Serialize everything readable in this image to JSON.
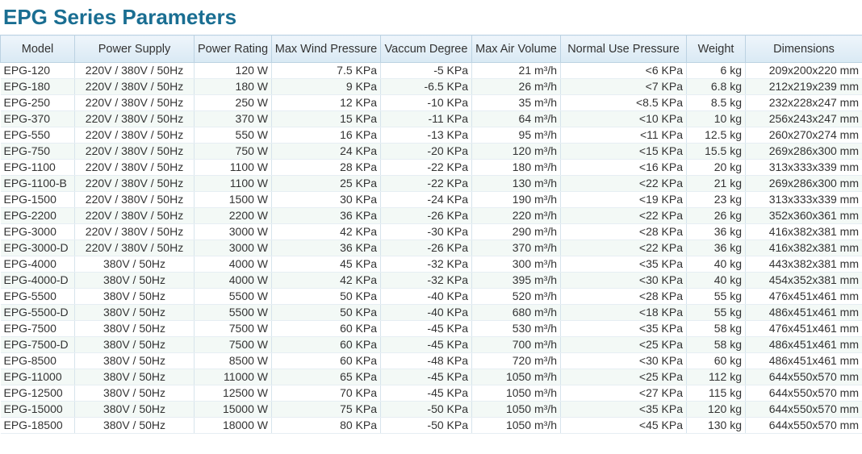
{
  "title": "EPG Series Parameters",
  "table": {
    "headers": [
      "Model",
      "Power Supply",
      "Power Rating",
      "Max Wind Pressure",
      "Vaccum Degree",
      "Max Air Volume",
      "Normal Use Pressure",
      "Weight",
      "Dimensions"
    ],
    "rows": [
      [
        "EPG-120",
        "220V / 380V / 50Hz",
        "120 W",
        "7.5 KPa",
        "-5 KPa",
        "21 m³/h",
        "<6 KPa",
        "6 kg",
        "209x200x220 mm"
      ],
      [
        "EPG-180",
        "220V / 380V / 50Hz",
        "180 W",
        "9 KPa",
        "-6.5 KPa",
        "26 m³/h",
        "<7 KPa",
        "6.8 kg",
        "212x219x239 mm"
      ],
      [
        "EPG-250",
        "220V / 380V / 50Hz",
        "250 W",
        "12 KPa",
        "-10 KPa",
        "35 m³/h",
        "<8.5 KPa",
        "8.5 kg",
        "232x228x247 mm"
      ],
      [
        "EPG-370",
        "220V / 380V / 50Hz",
        "370 W",
        "15 KPa",
        "-11 KPa",
        "64 m³/h",
        "<10 KPa",
        "10 kg",
        "256x243x247 mm"
      ],
      [
        "EPG-550",
        "220V / 380V / 50Hz",
        "550 W",
        "16 KPa",
        "-13 KPa",
        "95 m³/h",
        "<11 KPa",
        "12.5 kg",
        "260x270x274 mm"
      ],
      [
        "EPG-750",
        "220V / 380V / 50Hz",
        "750 W",
        "24 KPa",
        "-20 KPa",
        "120 m³/h",
        "<15 KPa",
        "15.5 kg",
        "269x286x300 mm"
      ],
      [
        "EPG-1100",
        "220V / 380V / 50Hz",
        "1100 W",
        "28 KPa",
        "-22 KPa",
        "180 m³/h",
        "<16 KPa",
        "20 kg",
        "313x333x339 mm"
      ],
      [
        "EPG-1100-B",
        "220V / 380V / 50Hz",
        "1100 W",
        "25 KPa",
        "-22 KPa",
        "130 m³/h",
        "<22 KPa",
        "21 kg",
        "269x286x300 mm"
      ],
      [
        "EPG-1500",
        "220V / 380V / 50Hz",
        "1500 W",
        "30 KPa",
        "-24 KPa",
        "190 m³/h",
        "<19 KPa",
        "23 kg",
        "313x333x339 mm"
      ],
      [
        "EPG-2200",
        "220V / 380V / 50Hz",
        "2200 W",
        "36 KPa",
        "-26 KPa",
        "220 m³/h",
        "<22 KPa",
        "26 kg",
        "352x360x361 mm"
      ],
      [
        "EPG-3000",
        "220V / 380V / 50Hz",
        "3000 W",
        "42 KPa",
        "-30 KPa",
        "290 m³/h",
        "<28 KPa",
        "36 kg",
        "416x382x381 mm"
      ],
      [
        "EPG-3000-D",
        "220V / 380V / 50Hz",
        "3000 W",
        "36 KPa",
        "-26 KPa",
        "370 m³/h",
        "<22 KPa",
        "36 kg",
        "416x382x381 mm"
      ],
      [
        "EPG-4000",
        "380V / 50Hz",
        "4000 W",
        "45 KPa",
        "-32 KPa",
        "300 m³/h",
        "<35 KPa",
        "40 kg",
        "443x382x381 mm"
      ],
      [
        "EPG-4000-D",
        "380V / 50Hz",
        "4000 W",
        "42 KPa",
        "-32 KPa",
        "395 m³/h",
        "<30 KPa",
        "40 kg",
        "454x352x381 mm"
      ],
      [
        "EPG-5500",
        "380V / 50Hz",
        "5500 W",
        "50 KPa",
        "-40 KPa",
        "520 m³/h",
        "<28 KPa",
        "55 kg",
        "476x451x461 mm"
      ],
      [
        "EPG-5500-D",
        "380V / 50Hz",
        "5500 W",
        "50 KPa",
        "-40 KPa",
        "680 m³/h",
        "<18 KPa",
        "55 kg",
        "486x451x461 mm"
      ],
      [
        "EPG-7500",
        "380V / 50Hz",
        "7500 W",
        "60 KPa",
        "-45 KPa",
        "530 m³/h",
        "<35 KPa",
        "58 kg",
        "476x451x461 mm"
      ],
      [
        "EPG-7500-D",
        "380V / 50Hz",
        "7500 W",
        "60 KPa",
        "-45 KPa",
        "700 m³/h",
        "<25 KPa",
        "58 kg",
        "486x451x461 mm"
      ],
      [
        "EPG-8500",
        "380V / 50Hz",
        "8500 W",
        "60 KPa",
        "-48 KPa",
        "720 m³/h",
        "<30 KPa",
        "60 kg",
        "486x451x461 mm"
      ],
      [
        "EPG-11000",
        "380V / 50Hz",
        "11000 W",
        "65 KPa",
        "-45 KPa",
        "1050 m³/h",
        "<25 KPa",
        "112 kg",
        "644x550x570 mm"
      ],
      [
        "EPG-12500",
        "380V / 50Hz",
        "12500 W",
        "70 KPa",
        "-45 KPa",
        "1050 m³/h",
        "<27 KPa",
        "115 kg",
        "644x550x570 mm"
      ],
      [
        "EPG-15000",
        "380V / 50Hz",
        "15000 W",
        "75 KPa",
        "-50 KPa",
        "1050 m³/h",
        "<35 KPa",
        "120 kg",
        "644x550x570 mm"
      ],
      [
        "EPG-18500",
        "380V / 50Hz",
        "18000 W",
        "80 KPa",
        "-50 KPa",
        "1050 m³/h",
        "<45 KPa",
        "130 kg",
        "644x550x570 mm"
      ]
    ]
  },
  "colors": {
    "title": "#1a6e92",
    "header_bg": "#d9e9f4",
    "row_alt_bg": "#f3f9f6",
    "grid": "#d7e4ec"
  }
}
